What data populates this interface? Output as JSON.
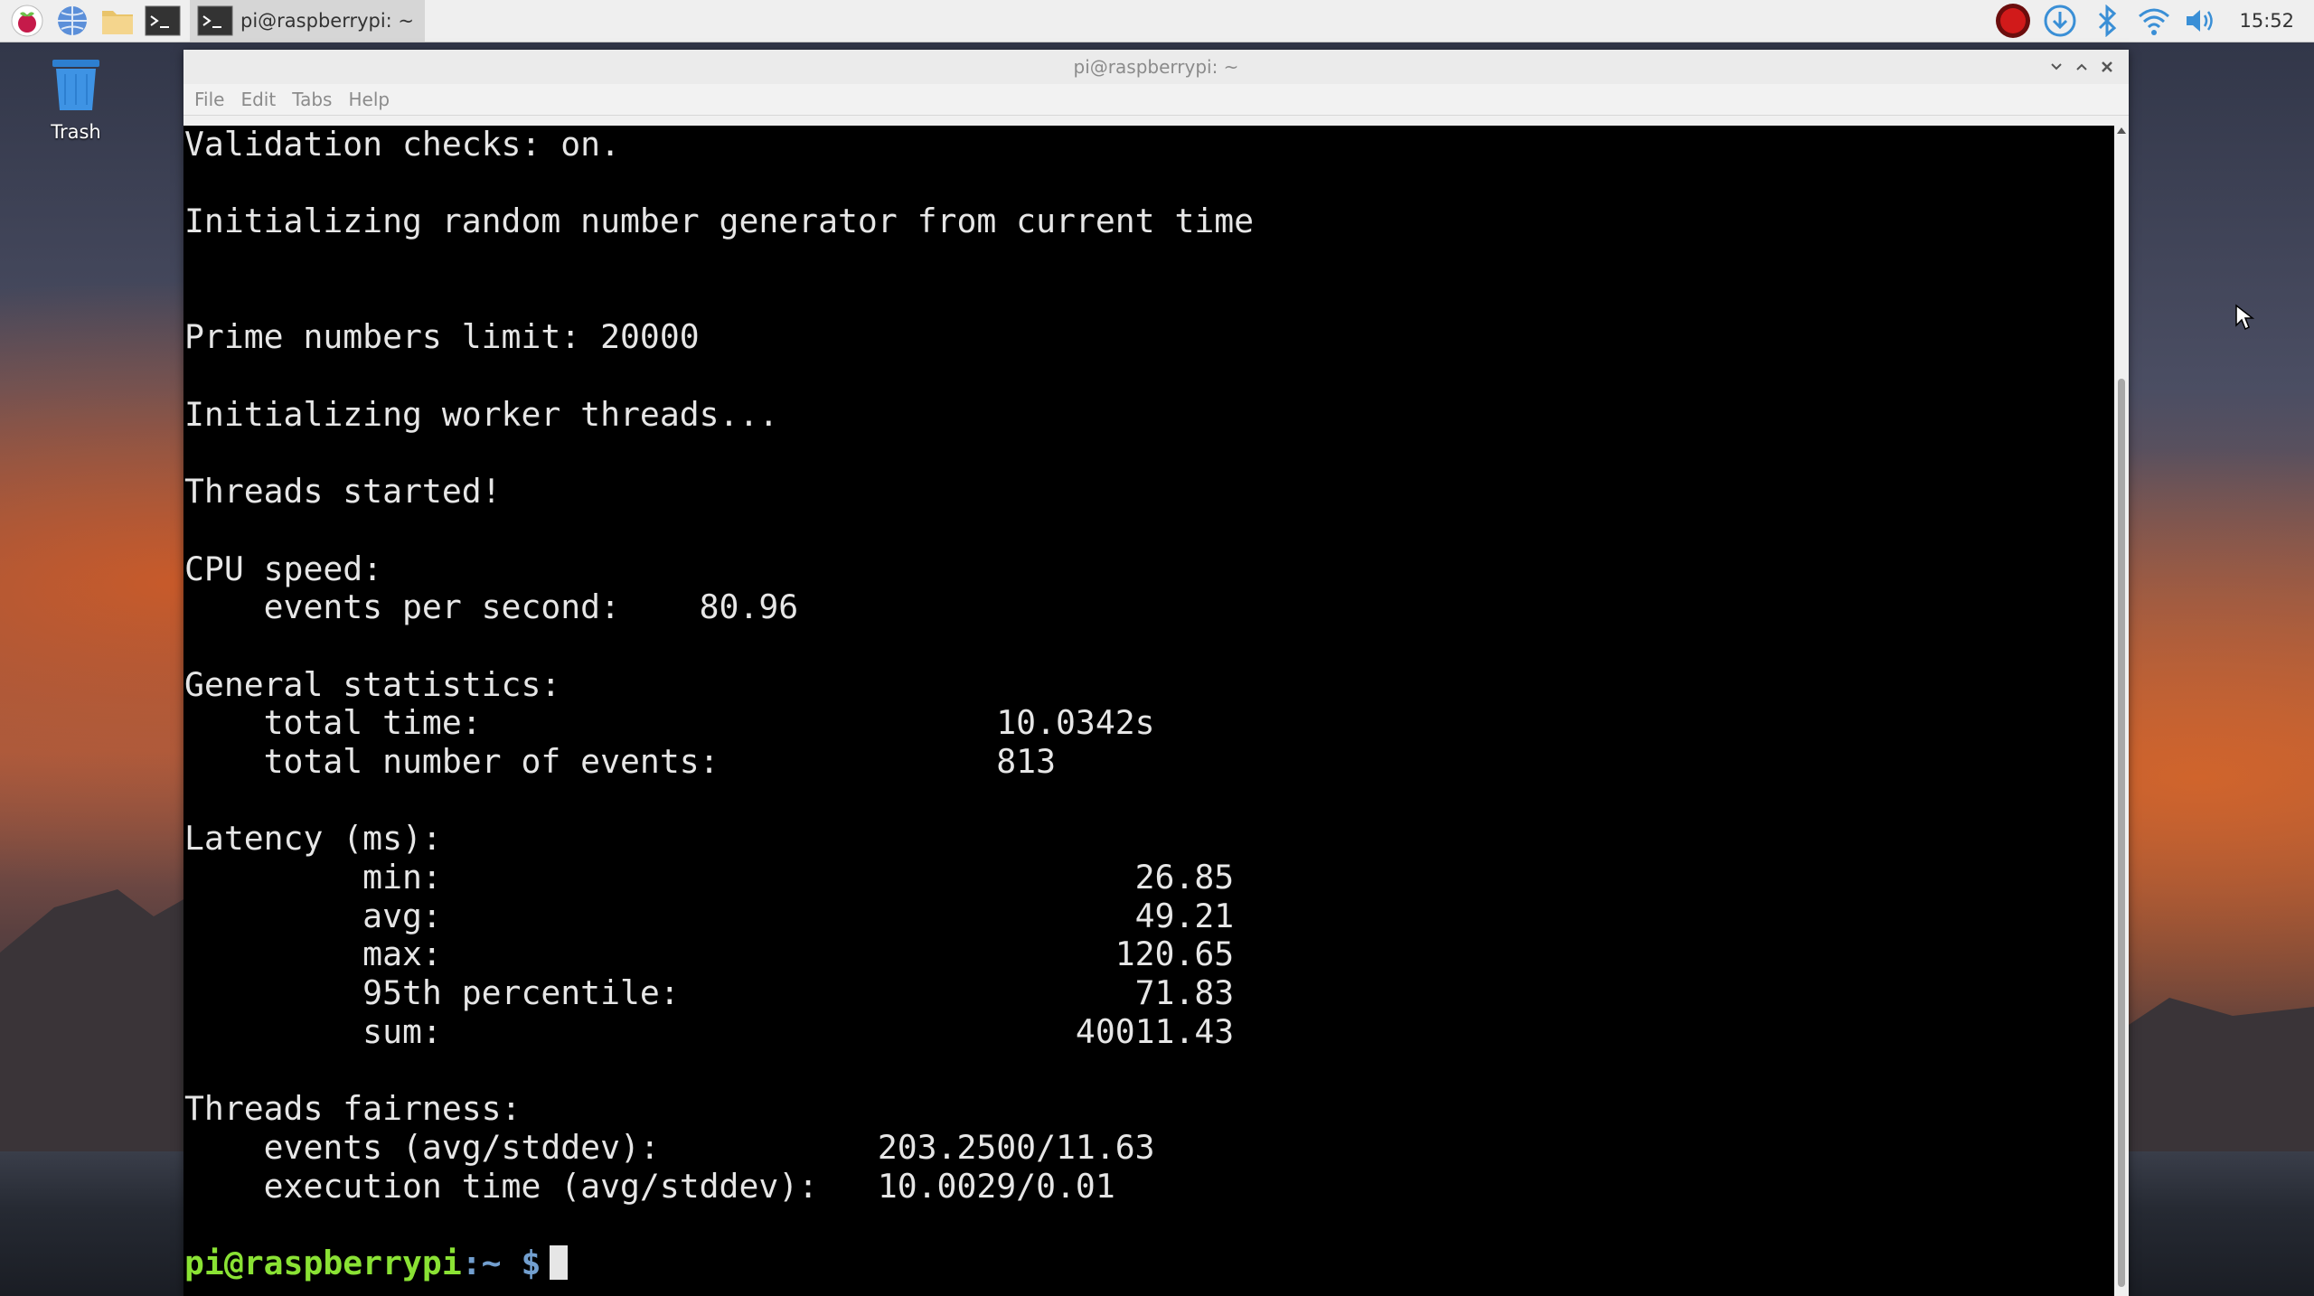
{
  "taskbar": {
    "launchers": [
      "raspberry-menu",
      "web-browser",
      "file-manager",
      "terminal"
    ],
    "task_label": "pi@raspberrypi: ~",
    "clock": "15:52"
  },
  "desktop": {
    "trash_label": "Trash"
  },
  "window": {
    "title": "pi@raspberrypi: ~",
    "menu": [
      "File",
      "Edit",
      "Tabs",
      "Help"
    ]
  },
  "terminal": {
    "lines": [
      "Validation checks: on.",
      "",
      "Initializing random number generator from current time",
      "",
      "",
      "Prime numbers limit: 20000",
      "",
      "Initializing worker threads...",
      "",
      "Threads started!",
      "",
      "CPU speed:",
      "    events per second:    80.96",
      "",
      "General statistics:",
      "    total time:                          10.0342s",
      "    total number of events:              813",
      "",
      "Latency (ms):",
      "         min:                                   26.85",
      "         avg:                                   49.21",
      "         max:                                  120.65",
      "         95th percentile:                       71.83",
      "         sum:                                40011.43",
      "",
      "Threads fairness:",
      "    events (avg/stddev):           203.2500/11.63",
      "    execution time (avg/stddev):   10.0029/0.01",
      ""
    ],
    "prompt_user": "pi@raspberrypi",
    "prompt_path": ":~",
    "prompt_dollar": " $"
  },
  "colors": {
    "prompt_user": "#8ae234",
    "prompt_path": "#729fcf",
    "terminal_bg": "#000000",
    "terminal_fg": "#e6e6e6"
  }
}
